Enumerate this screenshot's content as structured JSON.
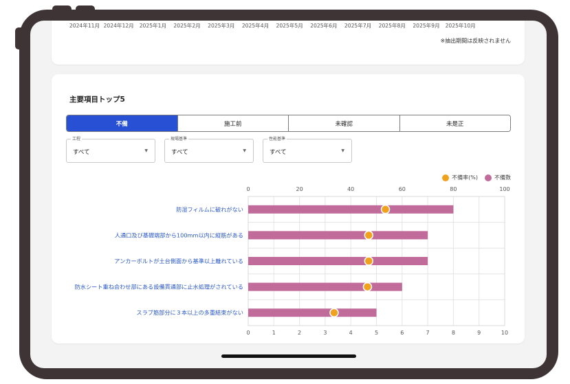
{
  "top_card": {
    "months": [
      "2024年11月",
      "2024年12月",
      "2025年1月",
      "2025年2月",
      "2025年3月",
      "2025年4月",
      "2025年5月",
      "2025年6月",
      "2025年7月",
      "2025年8月",
      "2025年9月",
      "2025年10月"
    ],
    "note": "※抽出期間は反映されません"
  },
  "section": {
    "title": "主要項目トップ5",
    "tabs": [
      {
        "label": "不備",
        "active": true
      },
      {
        "label": "施工前",
        "active": false
      },
      {
        "label": "未確認",
        "active": false
      },
      {
        "label": "未是正",
        "active": false
      }
    ],
    "filters": [
      {
        "label": "工程",
        "value": "すべて"
      },
      {
        "label": "現場基準",
        "value": "すべて"
      },
      {
        "label": "性能基準",
        "value": "すべて"
      }
    ]
  },
  "legend": [
    {
      "label": "不備率(%)",
      "color": "#f0a21e"
    },
    {
      "label": "不備数",
      "color": "#c06b9a"
    }
  ],
  "chart_data": {
    "type": "bar",
    "orientation": "horizontal",
    "categories": [
      "防湿フィルムに破れがない",
      "人通口及び基礎端部から100mm以内に縦筋がある",
      "アンカーボルトが土台側面から基準以上離れている",
      "防水シート重ね合わせ部にある設備貫通部に止水処理がされている",
      "スラブ筋部分に３本以上の多重結束がない"
    ],
    "series": [
      {
        "name": "不備数",
        "type": "bar",
        "axis": "bottom",
        "color": "#c06b9a",
        "values": [
          8,
          7,
          7,
          6,
          5
        ]
      },
      {
        "name": "不備率(%)",
        "type": "scatter",
        "axis": "top",
        "color": "#f0a21e",
        "values": [
          53.5,
          47,
          47,
          46.5,
          33.5
        ]
      }
    ],
    "top_axis": {
      "range": [
        0,
        100
      ],
      "ticks": [
        0,
        20,
        40,
        60,
        80,
        100
      ]
    },
    "bottom_axis": {
      "range": [
        0,
        10
      ],
      "ticks": [
        0,
        1,
        2,
        3,
        4,
        5,
        6,
        7,
        8,
        9,
        10
      ]
    },
    "grid": true,
    "legend_position": "top-right"
  }
}
